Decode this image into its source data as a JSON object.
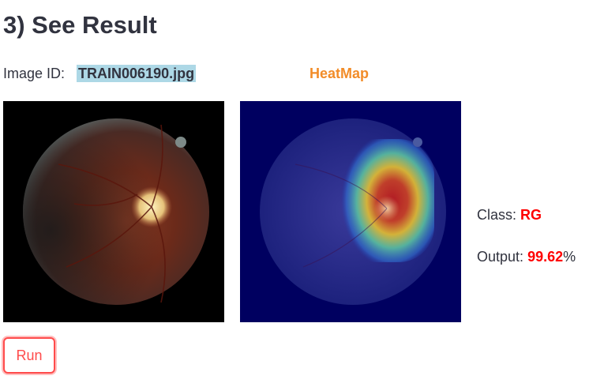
{
  "section": {
    "title": "3) See Result"
  },
  "image_info": {
    "label": "Image ID:",
    "value": "TRAIN006190.jpg"
  },
  "heatmap": {
    "label": "HeatMap"
  },
  "result": {
    "class_label": "Class:",
    "class_value": "RG",
    "output_label": "Output:",
    "output_value": "99.62",
    "output_unit": "%"
  },
  "run_button": {
    "label": "Run"
  },
  "colors": {
    "accent_red": "#ff4b4b",
    "heatmap_label": "#f28c28",
    "highlight": "#add8e6",
    "value_red": "#ff0000"
  }
}
